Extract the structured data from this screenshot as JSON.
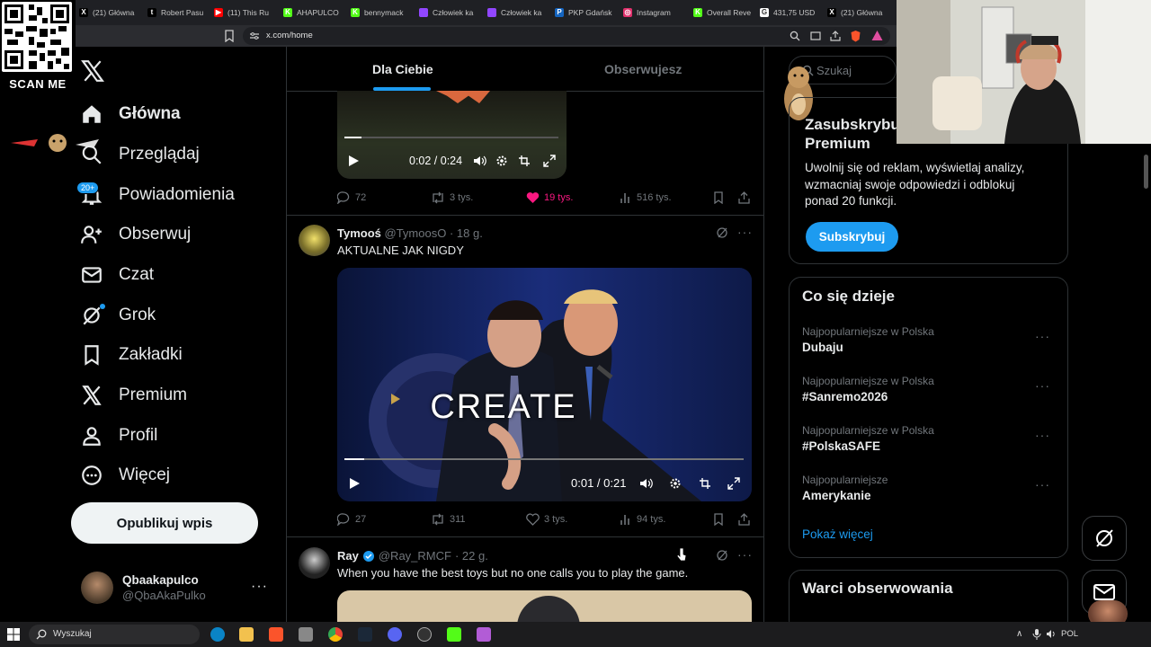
{
  "browser": {
    "tabs": [
      {
        "label": "(21) Główna",
        "color": "#000000",
        "glyph": "X"
      },
      {
        "label": "Robert Pasu",
        "color": "#000000",
        "glyph": "t"
      },
      {
        "label": "(11) This Ru",
        "color": "#ff0000",
        "glyph": "▶"
      },
      {
        "label": "AHAPULCO",
        "color": "#53fc18",
        "glyph": "K"
      },
      {
        "label": "bennymack",
        "color": "#53fc18",
        "glyph": "K"
      },
      {
        "label": "Człowiek ka",
        "color": "#9146ff",
        "glyph": ""
      },
      {
        "label": "Człowiek ka",
        "color": "#9146ff",
        "glyph": ""
      },
      {
        "label": "PKP Gdańsk",
        "color": "#1565c0",
        "glyph": "P"
      },
      {
        "label": "Instagram",
        "color": "#e1306c",
        "glyph": "◎"
      },
      {
        "label": "Overall Reve",
        "color": "#53fc18",
        "glyph": "K"
      },
      {
        "label": "431,75 USD",
        "color": "#ffffff",
        "glyph": "G"
      },
      {
        "label": "(21) Główna",
        "color": "#000000",
        "glyph": "X"
      }
    ],
    "url": "x.com/home"
  },
  "qr": {
    "label": "SCAN ME"
  },
  "nav": {
    "items": [
      {
        "label": "Główna",
        "icon": "home-icon"
      },
      {
        "label": "Przeglądaj",
        "icon": "search-icon"
      },
      {
        "label": "Powiadomienia",
        "icon": "bell-icon"
      },
      {
        "label": "Obserwuj",
        "icon": "follow-icon"
      },
      {
        "label": "Czat",
        "icon": "mail-icon"
      },
      {
        "label": "Grok",
        "icon": "grok-icon"
      },
      {
        "label": "Zakładki",
        "icon": "bookmark-icon"
      },
      {
        "label": "Premium",
        "icon": "x-icon"
      },
      {
        "label": "Profil",
        "icon": "person-icon"
      },
      {
        "label": "Więcej",
        "icon": "more-circle-icon"
      }
    ],
    "notif_badge": "20+",
    "post_button": "Opublikuj wpis",
    "account": {
      "name": "Qbaakapulco",
      "handle": "@QbaAkaPulko"
    }
  },
  "feed": {
    "tabs": [
      "Dla Ciebie",
      "Obserwujesz"
    ],
    "post1": {
      "time": "0:02 / 0:24",
      "progress": 0.08,
      "replies": "72",
      "reposts": "3 tys.",
      "likes": "19 tys.",
      "views": "516 tys."
    },
    "post2": {
      "name": "Tymooś",
      "handle": "@TymoosO",
      "age": "· 18 g.",
      "text": "AKTUALNE JAK NIGDY",
      "overlay": "CREATE",
      "time": "0:01 / 0:21",
      "progress": 0.05,
      "replies": "27",
      "reposts": "311",
      "likes": "3 tys.",
      "views": "94 tys."
    },
    "post3": {
      "name": "Ray",
      "handle": "@Ray_RMCF",
      "age": "· 22 g.",
      "text": "When you have the best toys but no one calls you to play the game."
    }
  },
  "sidebar": {
    "search_placeholder": "Szukaj",
    "premium": {
      "title": "Zasubskrybuj Premium",
      "body": "Uwolnij się od reklam, wyświetlaj analizy, wzmacniaj swoje odpowiedzi i odblokuj ponad 20 funkcji.",
      "button": "Subskrybuj"
    },
    "trends_title": "Co się dzieje",
    "trends": [
      {
        "category": "Najpopularniejsze w Polska",
        "name": "Dubaju"
      },
      {
        "category": "Najpopularniejsze w Polska",
        "name": "#Sanremo2026"
      },
      {
        "category": "Najpopularniejsze w Polska",
        "name": "#PolskaSAFE"
      },
      {
        "category": "Najpopularniejsze",
        "name": "Amerykanie"
      }
    ],
    "show_more": "Pokaż więcej",
    "follow_title": "Warci obserwowania"
  },
  "taskbar": {
    "search": "Wyszukaj",
    "lang": "POL"
  },
  "colors": {
    "accent": "#1d9bf0",
    "like": "#f91880",
    "bg": "#000000",
    "border": "#2f3336",
    "muted": "#71767b"
  }
}
